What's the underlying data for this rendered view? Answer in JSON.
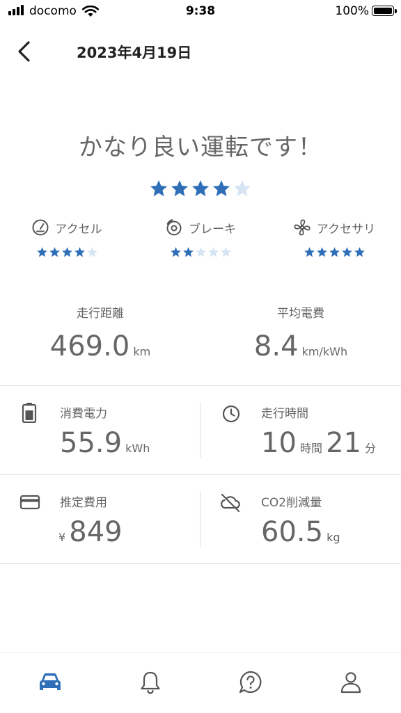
{
  "status_bar": {
    "carrier": "docomo",
    "time": "9:38",
    "battery": "100%"
  },
  "header": {
    "title": "2023年4月19日"
  },
  "rating": {
    "headline": "かなり良い運転です！",
    "overall_stars": 4,
    "categories": [
      {
        "label": "アクセル",
        "icon": "speedometer-icon",
        "stars": 4
      },
      {
        "label": "ブレーキ",
        "icon": "brake-disc-icon",
        "stars": 2
      },
      {
        "label": "アクセサリ",
        "icon": "fan-icon",
        "stars": 5
      }
    ]
  },
  "summary": {
    "distance": {
      "label": "走行距離",
      "value": "469.0",
      "unit": "km"
    },
    "efficiency": {
      "label": "平均電費",
      "value": "8.4",
      "unit": "km/kWh"
    }
  },
  "details": {
    "power": {
      "label": "消費電力",
      "value": "55.9",
      "unit": "kWh",
      "icon": "battery-icon"
    },
    "drive_time": {
      "label": "走行時間",
      "hours": "10",
      "hours_unit": "時間",
      "minutes": "21",
      "minutes_unit": "分",
      "icon": "clock-icon"
    },
    "cost": {
      "label": "推定費用",
      "currency": "¥",
      "value": "849",
      "icon": "credit-card-icon"
    },
    "co2": {
      "label": "CO2削減量",
      "value": "60.5",
      "unit": "kg",
      "icon": "cloud-off-icon"
    }
  },
  "tabs": [
    {
      "name": "car-icon",
      "active": true
    },
    {
      "name": "bell-icon",
      "active": false
    },
    {
      "name": "help-icon",
      "active": false
    },
    {
      "name": "profile-icon",
      "active": false
    }
  ],
  "colors": {
    "star_filled": "#2f6fb8",
    "star_empty": "#d6e4f3",
    "tab_active": "#2f6fb8",
    "tab_inactive": "#555555"
  }
}
